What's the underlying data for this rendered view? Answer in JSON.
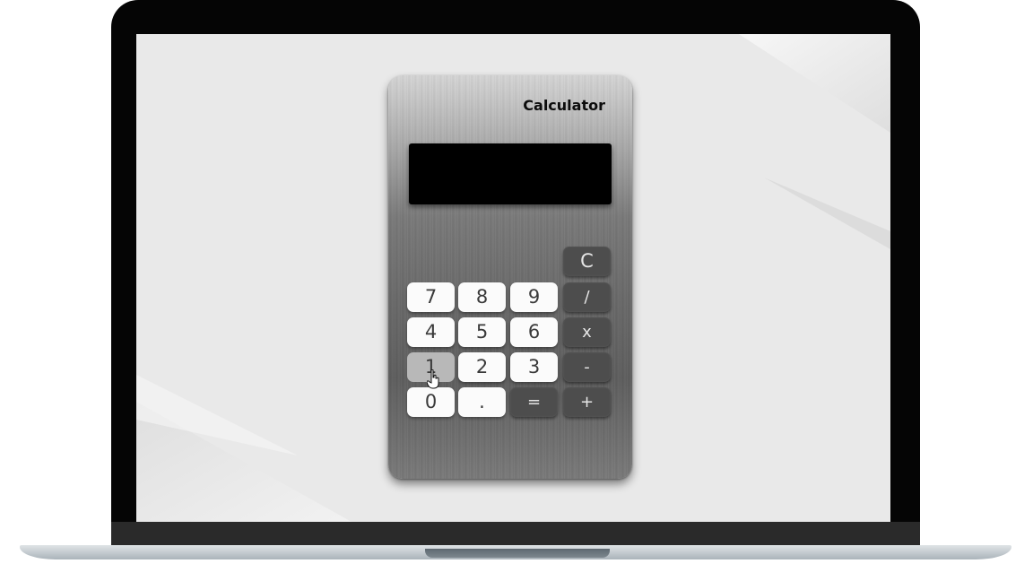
{
  "calculator": {
    "title": "Calculator",
    "display_value": ""
  },
  "keys": {
    "clear": "C",
    "seven": "7",
    "eight": "8",
    "nine": "9",
    "divide": "/",
    "four": "4",
    "five": "5",
    "six": "6",
    "multiply": "x",
    "one": "1",
    "two": "2",
    "three": "3",
    "subtract": "-",
    "zero": "0",
    "decimal": ".",
    "equals": "=",
    "add": "+"
  },
  "colors": {
    "screen_bg": "#e9e9e9",
    "display_bg": "#000000",
    "light_key": "#fbfbfb",
    "dark_key": "#4d4d4d",
    "pressed_key": "#b8b8b8"
  }
}
